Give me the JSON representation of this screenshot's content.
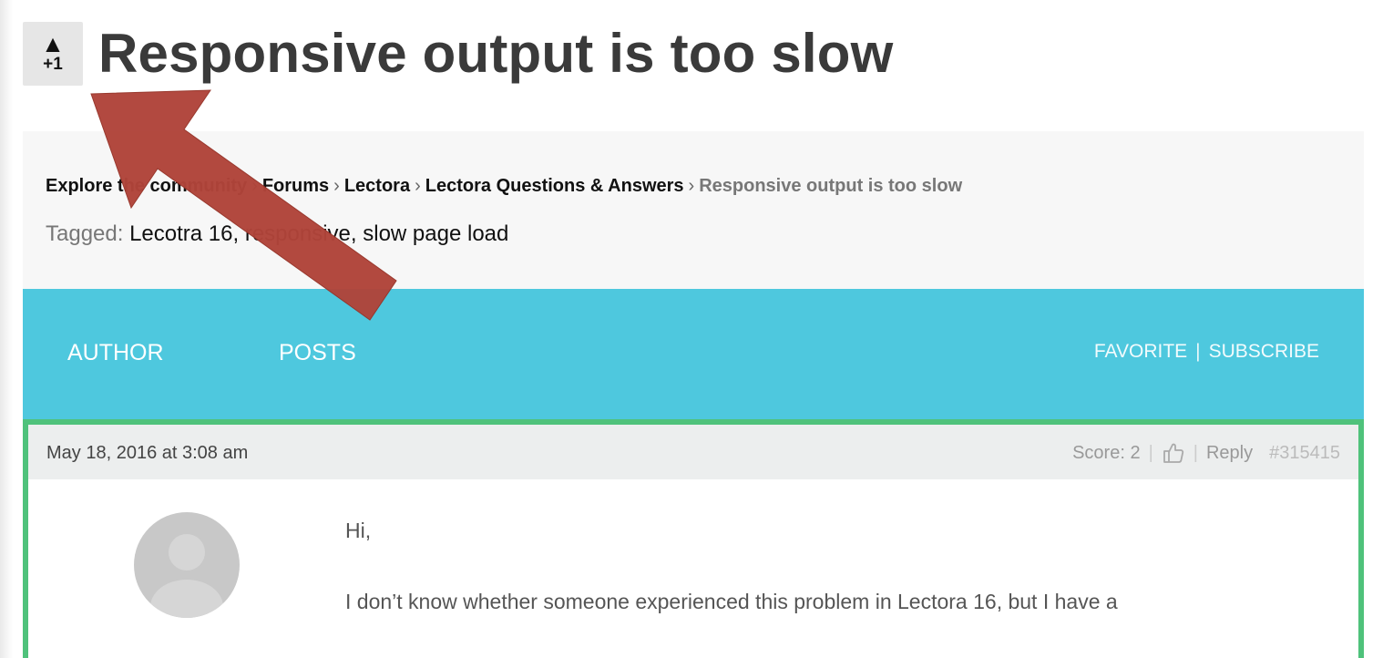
{
  "topic": {
    "vote_arrow": "▲",
    "vote_count": "+1",
    "title": "Responsive output is too slow"
  },
  "breadcrumb": {
    "items": [
      "Explore the community",
      "Forums",
      "Lectora",
      "Lectora Questions & Answers"
    ],
    "separator": "›",
    "current": "Responsive output is too slow"
  },
  "tags": {
    "label": "Tagged:",
    "items": [
      "Lecotra 16",
      "responsive",
      "slow page load"
    ]
  },
  "header": {
    "author": "AUTHOR",
    "posts": "POSTS",
    "favorite": "FAVORITE",
    "divider": "|",
    "subscribe": "SUBSCRIBE"
  },
  "reply": {
    "date": "May 18, 2016 at 3:08 am",
    "score": "Score: 2",
    "reply_label": "Reply",
    "permalink": "#315415",
    "body": [
      "Hi,",
      "I don’t know whether someone experienced this problem in Lectora 16, but I have a"
    ]
  },
  "icons": {
    "vote": "upvote-icon",
    "thumb": "thumbs-up-icon",
    "avatar": "default-avatar",
    "annotation": "red-arrow-annotation"
  },
  "colors": {
    "header_bg": "#4ec8de",
    "reply_border": "#4fc27b",
    "arrow": "#b0443a",
    "title": "#3a3a3a"
  }
}
